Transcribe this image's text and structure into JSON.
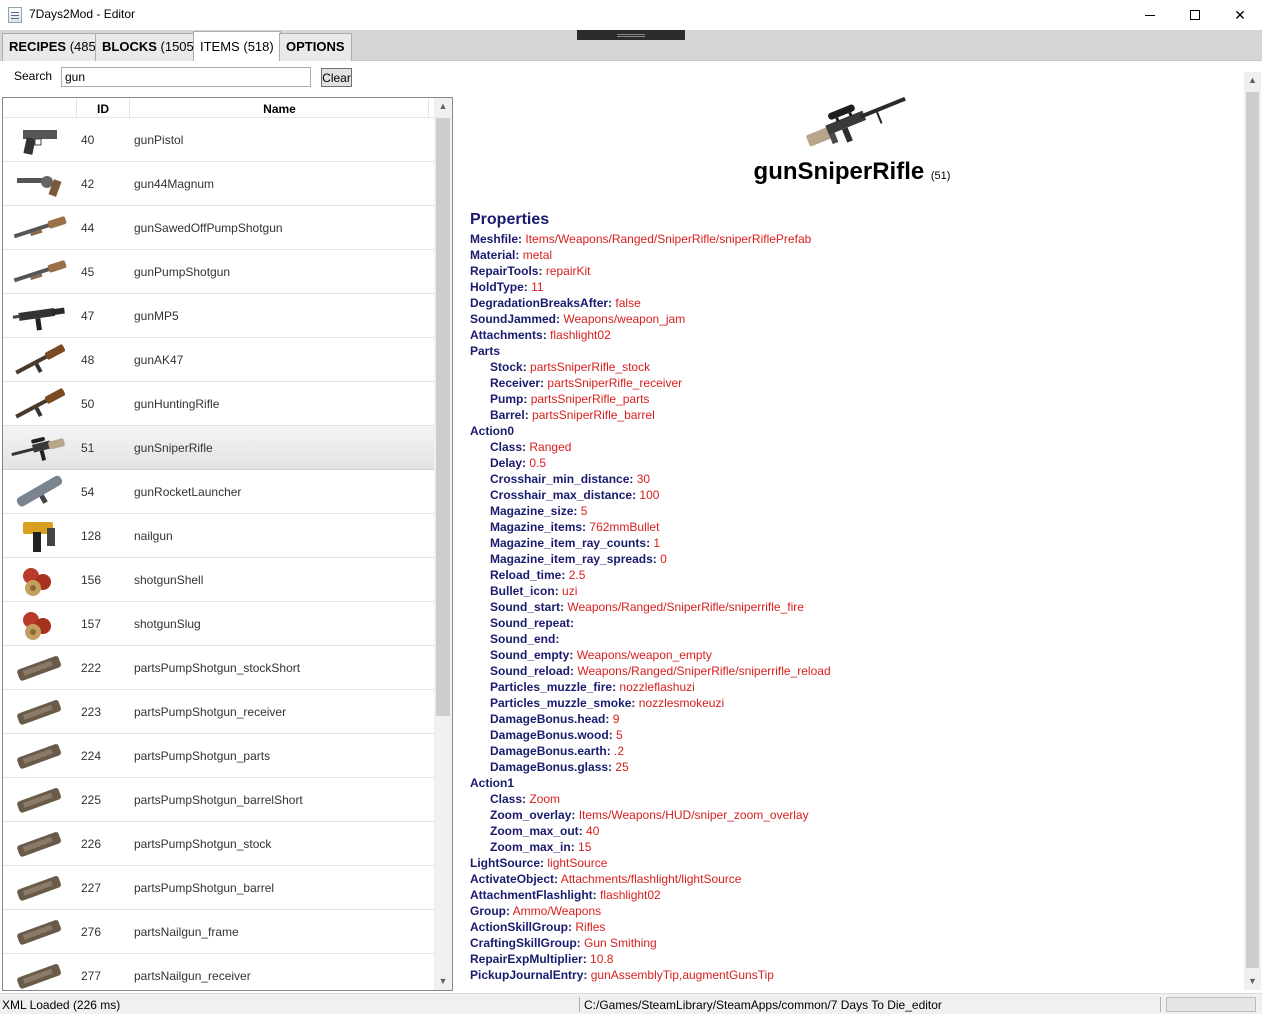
{
  "window": {
    "title": "7Days2Mod - Editor"
  },
  "tabs": [
    {
      "label": "RECIPES",
      "count": "(485)"
    },
    {
      "label": "BLOCKS",
      "count": "(1505)"
    },
    {
      "label": "ITEMS",
      "count": "(518)"
    },
    {
      "label": "OPTIONS",
      "count": ""
    }
  ],
  "search": {
    "label": "Search",
    "value": "gun",
    "clear_label": "Clear"
  },
  "list": {
    "headers": {
      "id": "ID",
      "name": "Name"
    },
    "rows": [
      {
        "id": "40",
        "name": "gunPistol",
        "icon": "pistol-icon"
      },
      {
        "id": "42",
        "name": "gun44Magnum",
        "icon": "revolver-icon"
      },
      {
        "id": "44",
        "name": "gunSawedOffPumpShotgun",
        "icon": "shotgun-icon"
      },
      {
        "id": "45",
        "name": "gunPumpShotgun",
        "icon": "shotgun-icon"
      },
      {
        "id": "47",
        "name": "gunMP5",
        "icon": "smg-icon"
      },
      {
        "id": "48",
        "name": "gunAK47",
        "icon": "rifle-icon"
      },
      {
        "id": "50",
        "name": "gunHuntingRifle",
        "icon": "rifle-icon"
      },
      {
        "id": "51",
        "name": "gunSniperRifle",
        "icon": "sniper-icon",
        "selected": true
      },
      {
        "id": "54",
        "name": "gunRocketLauncher",
        "icon": "launcher-icon"
      },
      {
        "id": "128",
        "name": "nailgun",
        "icon": "nailgun-icon"
      },
      {
        "id": "156",
        "name": "shotgunShell",
        "icon": "shell-icon"
      },
      {
        "id": "157",
        "name": "shotgunSlug",
        "icon": "shell-icon"
      },
      {
        "id": "222",
        "name": "partsPumpShotgun_stockShort",
        "icon": "part-icon"
      },
      {
        "id": "223",
        "name": "partsPumpShotgun_receiver",
        "icon": "part-icon"
      },
      {
        "id": "224",
        "name": "partsPumpShotgun_parts",
        "icon": "part-icon"
      },
      {
        "id": "225",
        "name": "partsPumpShotgun_barrelShort",
        "icon": "part-icon"
      },
      {
        "id": "226",
        "name": "partsPumpShotgun_stock",
        "icon": "part-icon"
      },
      {
        "id": "227",
        "name": "partsPumpShotgun_barrel",
        "icon": "part-icon"
      },
      {
        "id": "276",
        "name": "partsNailgun_frame",
        "icon": "part-icon"
      },
      {
        "id": "277",
        "name": "partsNailgun_receiver",
        "icon": "part-icon"
      }
    ]
  },
  "detail": {
    "title": "gunSniperRifle",
    "id": "(51)",
    "section": "Properties",
    "properties": [
      {
        "k": "Meshfile",
        "v": "Items/Weapons/Ranged/SniperRifle/sniperRiflePrefab",
        "indent": 0
      },
      {
        "k": "Material",
        "v": "metal",
        "indent": 0
      },
      {
        "k": "RepairTools",
        "v": "repairKit",
        "indent": 0
      },
      {
        "k": "HoldType",
        "v": "11",
        "indent": 0
      },
      {
        "k": "DegradationBreaksAfter",
        "v": "false",
        "indent": 0
      },
      {
        "k": "SoundJammed",
        "v": "Weapons/weapon_jam",
        "indent": 0
      },
      {
        "k": "Attachments",
        "v": "flashlight02",
        "indent": 0
      },
      {
        "k": "Parts",
        "v": null,
        "indent": 0
      },
      {
        "k": "Stock",
        "v": "partsSniperRifle_stock",
        "indent": 1
      },
      {
        "k": "Receiver",
        "v": "partsSniperRifle_receiver",
        "indent": 1
      },
      {
        "k": "Pump",
        "v": "partsSniperRifle_parts",
        "indent": 1
      },
      {
        "k": "Barrel",
        "v": "partsSniperRifle_barrel",
        "indent": 1
      },
      {
        "k": "Action0",
        "v": null,
        "indent": 0
      },
      {
        "k": "Class",
        "v": "Ranged",
        "indent": 1
      },
      {
        "k": "Delay",
        "v": "0.5",
        "indent": 1
      },
      {
        "k": "Crosshair_min_distance",
        "v": "30",
        "indent": 1
      },
      {
        "k": "Crosshair_max_distance",
        "v": "100",
        "indent": 1
      },
      {
        "k": "Magazine_size",
        "v": "5",
        "indent": 1
      },
      {
        "k": "Magazine_items",
        "v": "762mmBullet",
        "indent": 1
      },
      {
        "k": "Magazine_item_ray_counts",
        "v": "1",
        "indent": 1
      },
      {
        "k": "Magazine_item_ray_spreads",
        "v": "0",
        "indent": 1
      },
      {
        "k": "Reload_time",
        "v": "2.5",
        "indent": 1
      },
      {
        "k": "Bullet_icon",
        "v": "uzi",
        "indent": 1
      },
      {
        "k": "Sound_start",
        "v": "Weapons/Ranged/SniperRifle/sniperrifle_fire",
        "indent": 1
      },
      {
        "k": "Sound_repeat",
        "v": "",
        "indent": 1
      },
      {
        "k": "Sound_end",
        "v": "",
        "indent": 1
      },
      {
        "k": "Sound_empty",
        "v": "Weapons/weapon_empty",
        "indent": 1
      },
      {
        "k": "Sound_reload",
        "v": "Weapons/Ranged/SniperRifle/sniperrifle_reload",
        "indent": 1
      },
      {
        "k": "Particles_muzzle_fire",
        "v": "nozzleflashuzi",
        "indent": 1
      },
      {
        "k": "Particles_muzzle_smoke",
        "v": "nozzlesmokeuzi",
        "indent": 1
      },
      {
        "k": "DamageBonus.head",
        "v": "9",
        "indent": 1
      },
      {
        "k": "DamageBonus.wood",
        "v": "5",
        "indent": 1
      },
      {
        "k": "DamageBonus.earth",
        "v": ".2",
        "indent": 1
      },
      {
        "k": "DamageBonus.glass",
        "v": "25",
        "indent": 1
      },
      {
        "k": "Action1",
        "v": null,
        "indent": 0
      },
      {
        "k": "Class",
        "v": "Zoom",
        "indent": 1
      },
      {
        "k": "Zoom_overlay",
        "v": "Items/Weapons/HUD/sniper_zoom_overlay",
        "indent": 1
      },
      {
        "k": "Zoom_max_out",
        "v": "40",
        "indent": 1
      },
      {
        "k": "Zoom_max_in",
        "v": "15",
        "indent": 1
      },
      {
        "k": "LightSource",
        "v": "lightSource",
        "indent": 0
      },
      {
        "k": "ActivateObject",
        "v": "Attachments/flashlight/lightSource",
        "indent": 0
      },
      {
        "k": "AttachmentFlashlight",
        "v": "flashlight02",
        "indent": 0
      },
      {
        "k": "Group",
        "v": "Ammo/Weapons",
        "indent": 0
      },
      {
        "k": "ActionSkillGroup",
        "v": "Rifles",
        "indent": 0
      },
      {
        "k": "CraftingSkillGroup",
        "v": "Gun Smithing",
        "indent": 0
      },
      {
        "k": "RepairExpMultiplier",
        "v": "10.8",
        "indent": 0
      },
      {
        "k": "PickupJournalEntry",
        "v": "gunAssemblyTip,augmentGunsTip",
        "indent": 0
      }
    ]
  },
  "status": {
    "left": "XML Loaded (226 ms)",
    "path": "C:/Games/SteamLibrary/SteamApps/common/7 Days To Die_editor"
  },
  "colors": {
    "key": "#1a1a6e",
    "value": "#d81e1e",
    "accent": "#d6d6d6"
  }
}
